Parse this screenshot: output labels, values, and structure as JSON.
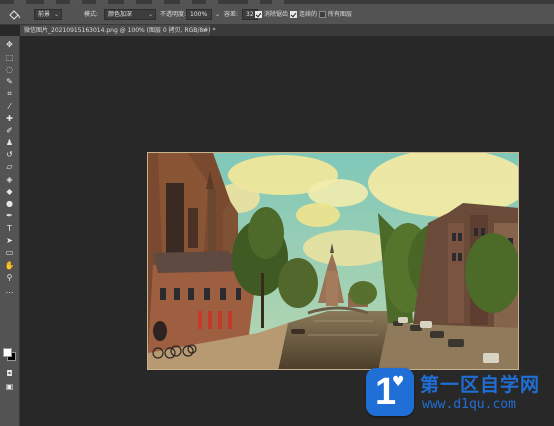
{
  "options_bar": {
    "tool_icon": "paint-bucket-icon",
    "source_select": "前景",
    "mode_label": "模式:",
    "mode_value": "颜色加深",
    "opacity_label": "不透明度:",
    "opacity_value": "100%",
    "tolerance_label": "容差:",
    "tolerance_value": "32",
    "antialias_label": "消除锯齿",
    "antialias_checked": true,
    "contiguous_label": "连续的",
    "contiguous_checked": true,
    "all_layers_label": "所有图层",
    "all_layers_checked": false
  },
  "document_tab": {
    "title": "微信图片_20210915163014.png @ 100% (图层 0 拷贝, RGB/8#) *",
    "close_glyph": "×"
  },
  "toolbar": {
    "tools": [
      {
        "name": "move-tool-icon",
        "glyph": "✥"
      },
      {
        "name": "marquee-tool-icon",
        "glyph": "⬚"
      },
      {
        "name": "lasso-tool-icon",
        "glyph": "◌"
      },
      {
        "name": "quick-select-tool-icon",
        "glyph": "✎"
      },
      {
        "name": "crop-tool-icon",
        "glyph": "⌗"
      },
      {
        "name": "eyedropper-tool-icon",
        "glyph": "⁄"
      },
      {
        "name": "healing-brush-tool-icon",
        "glyph": "✚"
      },
      {
        "name": "brush-tool-icon",
        "glyph": "✐"
      },
      {
        "name": "clone-stamp-tool-icon",
        "glyph": "♟"
      },
      {
        "name": "history-brush-tool-icon",
        "glyph": "↺"
      },
      {
        "name": "eraser-tool-icon",
        "glyph": "▱"
      },
      {
        "name": "paint-bucket-tool-icon",
        "glyph": "◈"
      },
      {
        "name": "blur-tool-icon",
        "glyph": "◆"
      },
      {
        "name": "dodge-tool-icon",
        "glyph": "●"
      },
      {
        "name": "pen-tool-icon",
        "glyph": "✒"
      },
      {
        "name": "type-tool-icon",
        "glyph": "T"
      },
      {
        "name": "path-select-tool-icon",
        "glyph": "➤"
      },
      {
        "name": "rectangle-tool-icon",
        "glyph": "▭"
      },
      {
        "name": "hand-tool-icon",
        "glyph": "✋"
      },
      {
        "name": "zoom-tool-icon",
        "glyph": "⚲"
      },
      {
        "name": "more-tools-icon",
        "glyph": "⋯"
      }
    ],
    "foreground_color": "#ffffff",
    "background_color": "#000000"
  },
  "watermark": {
    "logo_text": "1",
    "title": "第一区自学网",
    "url": "www.d1qu.com",
    "color": "#1f6fd6"
  }
}
